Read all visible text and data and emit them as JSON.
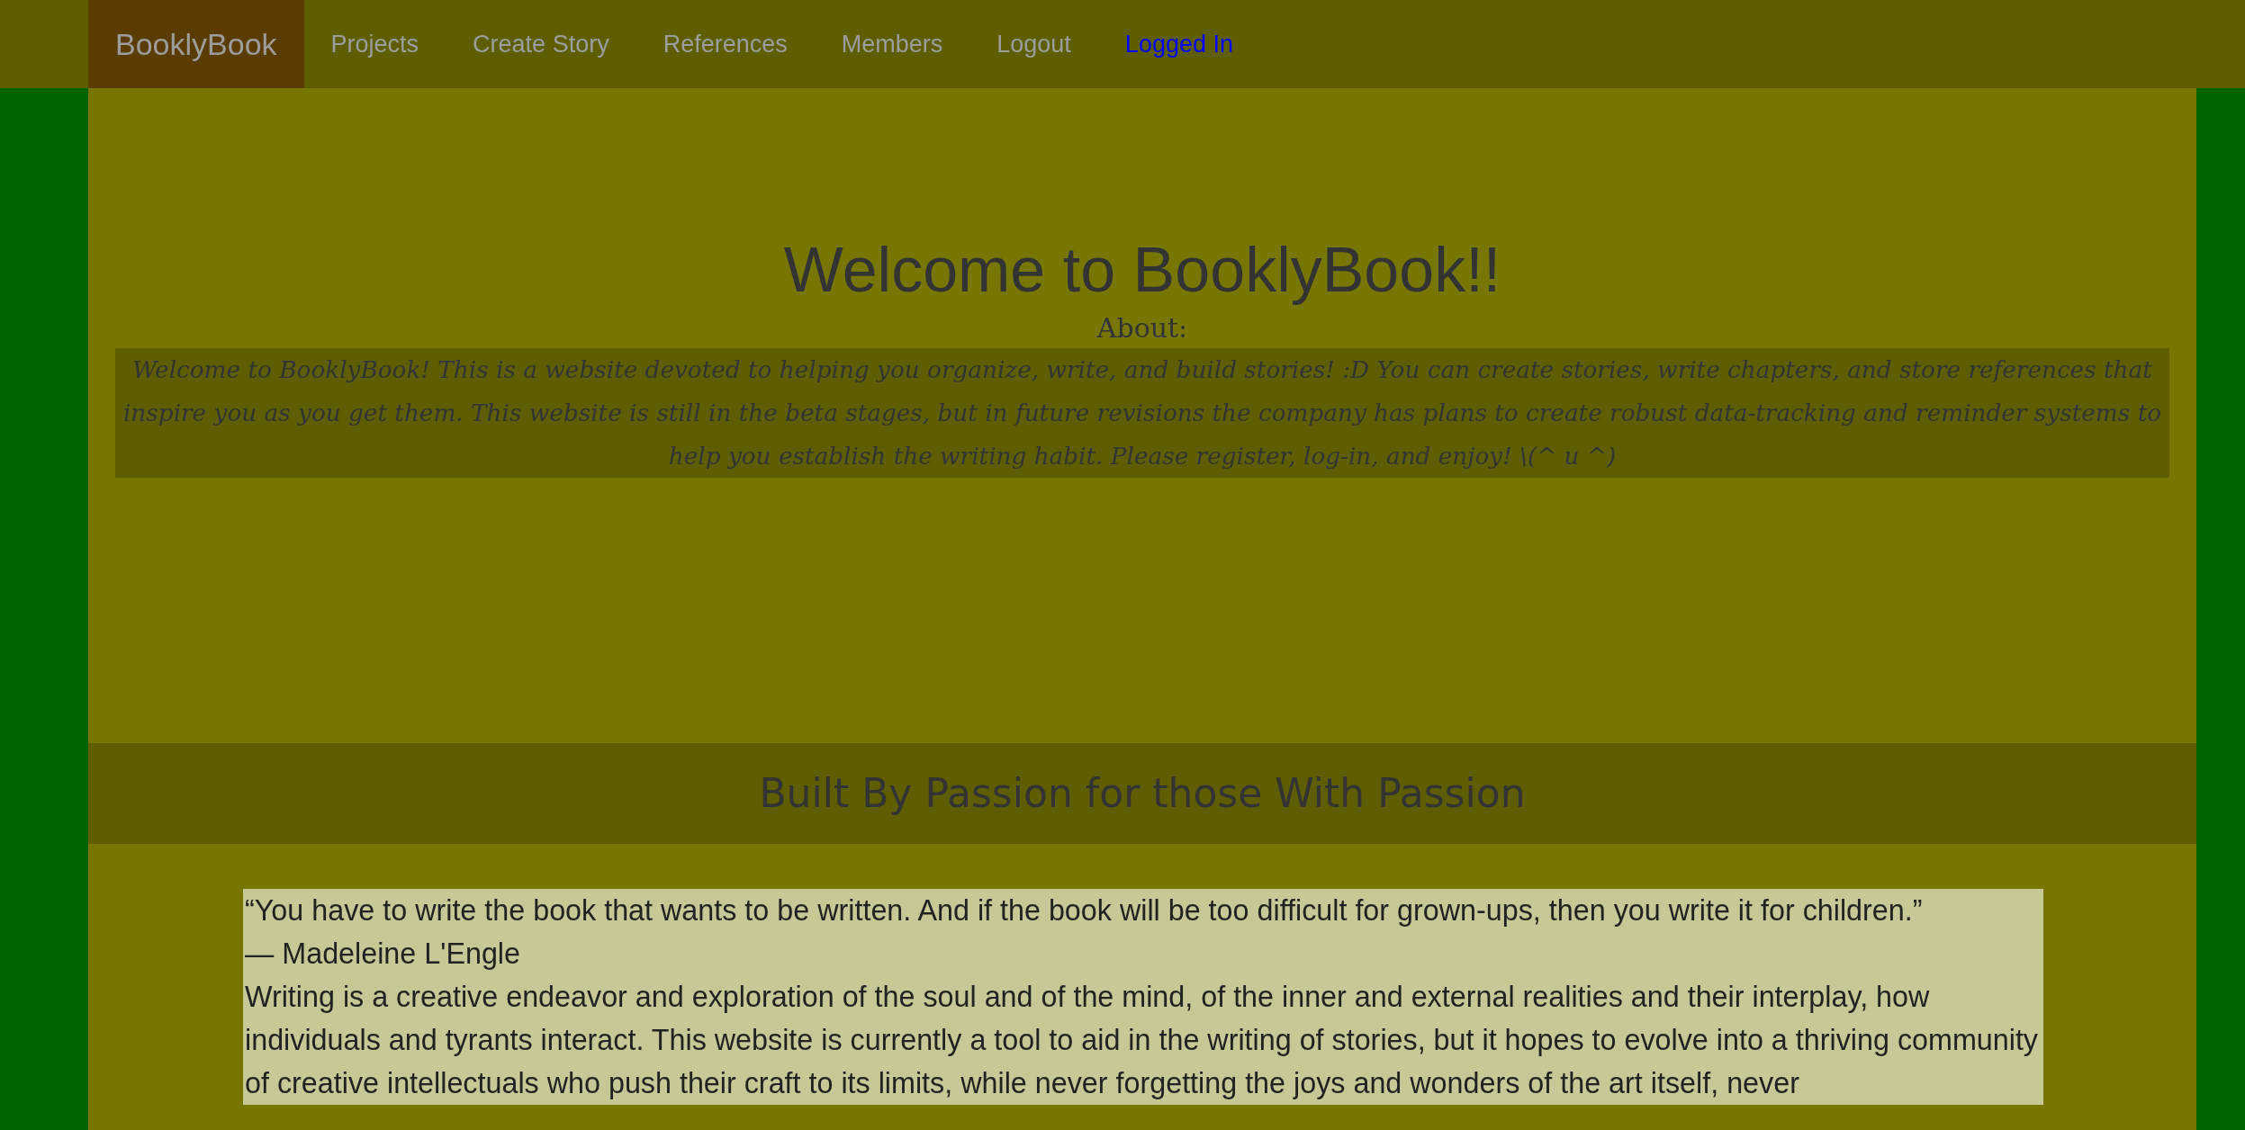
{
  "navbar": {
    "brand": "BooklyBook",
    "links": [
      {
        "label": "Projects",
        "kind": "nav"
      },
      {
        "label": "Create Story",
        "kind": "nav"
      },
      {
        "label": "References",
        "kind": "nav"
      },
      {
        "label": "Members",
        "kind": "nav"
      },
      {
        "label": "Logout",
        "kind": "nav"
      },
      {
        "label": "Logged In",
        "kind": "status"
      }
    ]
  },
  "hero": {
    "title": "Welcome to BooklyBook!!",
    "subtitle": "About:",
    "about": "Welcome to BooklyBook! This is a website devoted to helping you organize, write, and build stories! :D You can create stories, write chapters, and store references that inspire you as you get them. This website is still in the beta stages, but in future revisions the company has plans to create robust data-tracking and reminder systems to help you establish the writing habit. Please register, log-in, and enjoy! \\(^ u ^)"
  },
  "banner": {
    "heading": "Built By Passion for those With Passion"
  },
  "content": {
    "quote": "“You have to write the book that wants to be written. And if the book will be too difficult for grown-ups, then you write it for children.”",
    "attribution": "— Madeleine L'Engle",
    "paragraph": "Writing is a creative endeavor and exploration of the soul and of the mind, of the inner and external realities and their interplay, how individuals and tyrants interact. This website is currently a tool to aid in the writing of stories, but it hopes to evolve into a thriving community of creative intellectuals who push their craft to its limits, while never forgetting the joys and wonders of the art itself, never"
  }
}
